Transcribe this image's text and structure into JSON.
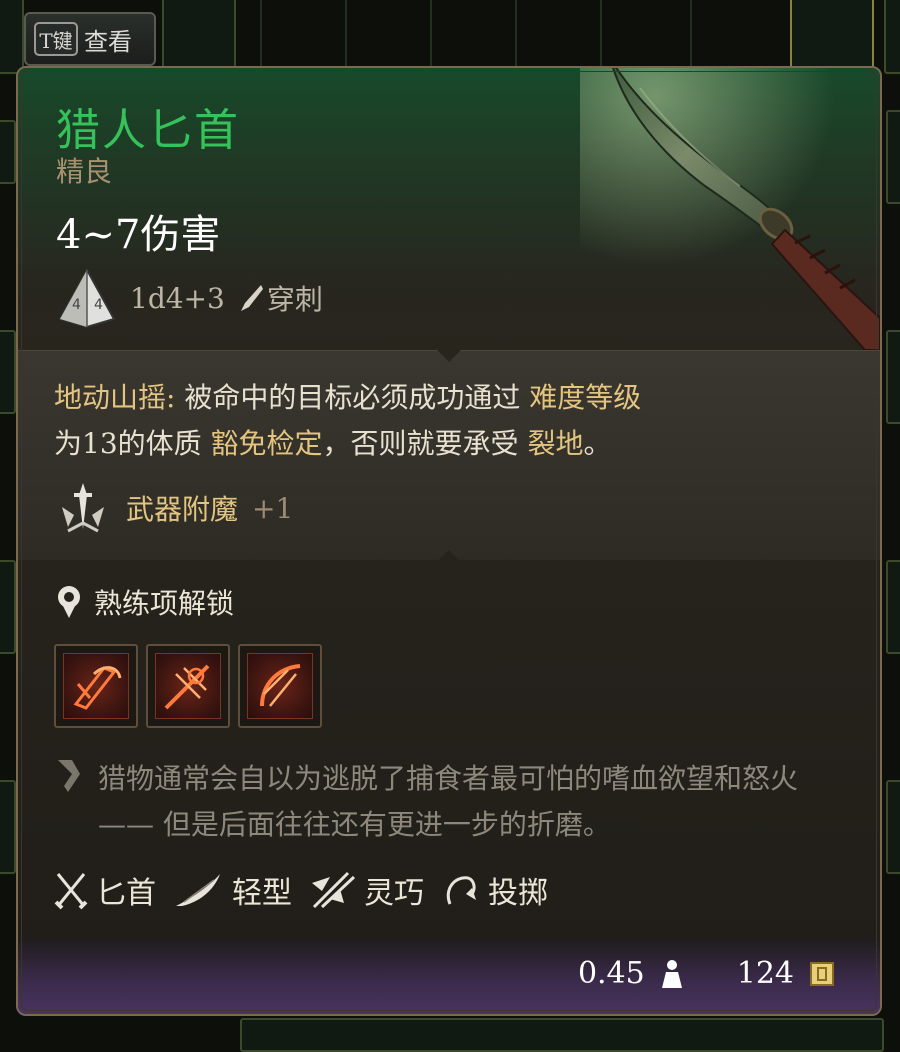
{
  "hint": {
    "key": "T键",
    "label": "查看"
  },
  "item": {
    "name": "猎人匕首",
    "rarity": "精良",
    "damage": "4~7伤害",
    "dice": "1d4+3",
    "damage_type": "穿刺",
    "dice_icon": "d4-dice-icon"
  },
  "effect": {
    "name": "地动山摇",
    "colon": ":",
    "text1": " 被命中的目标必须成功通过 ",
    "kw1": "难度等级",
    "text2": "为13的体质 ",
    "kw2": "豁免检定",
    "text3": "，否则就要承受 ",
    "kw3": "裂地",
    "text4": "。"
  },
  "enchant": {
    "label": "武器附魔",
    "value": "+1"
  },
  "proficiency": {
    "label": "熟练项解锁",
    "actions": [
      "action-slash-icon",
      "action-pierce-icon",
      "action-cut-icon"
    ]
  },
  "flavor": "猎物通常会自以为逃脱了捕食者最可怕的嗜血欲望和怒火 —— 但是后面往往还有更进一步的折磨。",
  "properties": [
    {
      "icon": "crossed-daggers-icon",
      "label": "匕首"
    },
    {
      "icon": "feather-icon",
      "label": "轻型"
    },
    {
      "icon": "finesse-icon",
      "label": "灵巧"
    },
    {
      "icon": "throw-icon",
      "label": "投掷"
    }
  ],
  "footer": {
    "weight": "0.45",
    "weight_icon": "weight-icon",
    "value": "124",
    "value_icon": "gold-icon"
  },
  "colors": {
    "title": "#35c25a",
    "keyword": "#e3c57f",
    "rarity": "#a89070"
  }
}
